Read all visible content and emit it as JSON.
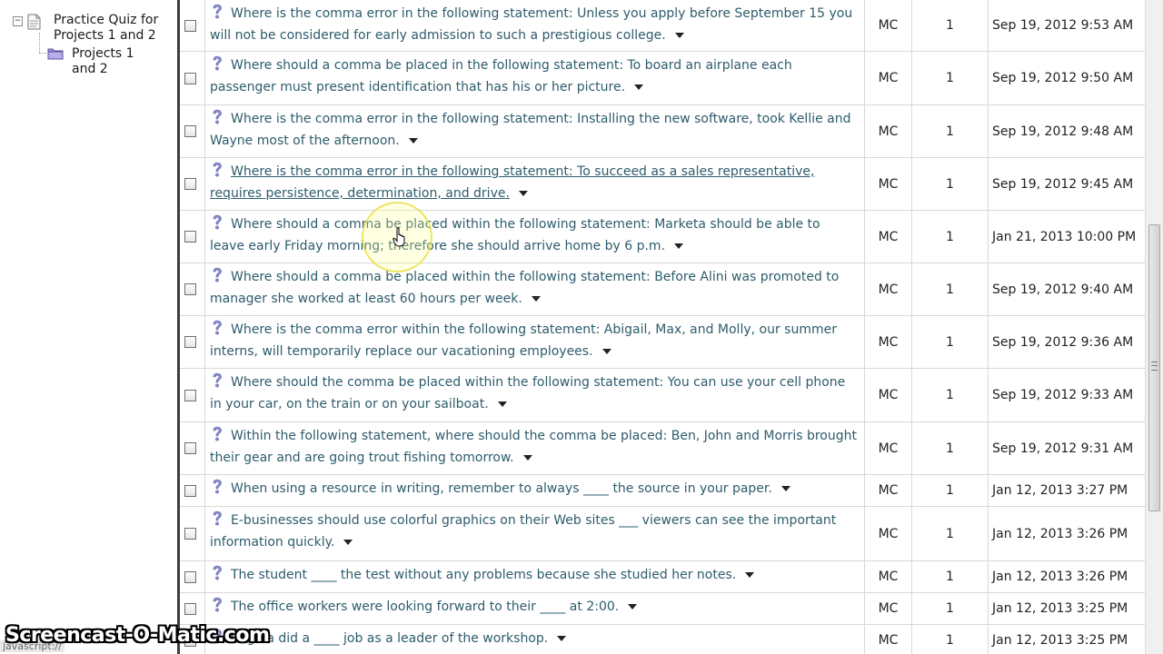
{
  "sidebar": {
    "tree": [
      {
        "label": "Practice Quiz for Projects 1 and 2",
        "icon": "document-icon",
        "expanded": true
      },
      {
        "label": "Projects 1 and 2",
        "icon": "folder-icon"
      }
    ],
    "toggle_symbol": "−"
  },
  "colors": {
    "question_text": "#2d5c6c",
    "divider": "#3c3c3c",
    "help_icon": "#8a8fce"
  },
  "questions": [
    {
      "text": "Where is the comma error in the following statement: Unless you apply before September 15 you will not be considered for early admission to such a prestigious college.",
      "type": "MC",
      "points": "1",
      "date": "Sep 19, 2012 9:53 AM"
    },
    {
      "text": "Where should a comma be placed in the following statement: To board an airplane each passenger must present identification that has his or her picture.",
      "type": "MC",
      "points": "1",
      "date": "Sep 19, 2012 9:50 AM"
    },
    {
      "text": "Where is the comma error in the following statement: Installing the new software, took Kellie and Wayne most of the afternoon.",
      "type": "MC",
      "points": "1",
      "date": "Sep 19, 2012 9:48 AM"
    },
    {
      "text": "Where is the comma error in the following statement: To succeed as a sales representative, requires persistence, determination, and drive.",
      "type": "MC",
      "points": "1",
      "date": "Sep 19, 2012 9:45 AM",
      "hovered": true
    },
    {
      "text": "Where should a comma be placed within the following statement: Marketa should be able to leave early Friday morning; therefore she should arrive home by 6 p.m.",
      "type": "MC",
      "points": "1",
      "date": "Jan 21, 2013 10:00 PM"
    },
    {
      "text": "Where should a comma be placed within the following statement: Before Alini was promoted to manager she worked at least 60 hours per week.",
      "type": "MC",
      "points": "1",
      "date": "Sep 19, 2012 9:40 AM"
    },
    {
      "text": "Where is the comma error within the following statement: Abigail, Max, and Molly, our summer interns, will temporarily replace our vacationing employees.",
      "type": "MC",
      "points": "1",
      "date": "Sep 19, 2012 9:36 AM"
    },
    {
      "text": "Where should the comma be placed within the following statement: You can use your cell phone in your car, on the train or on your sailboat.",
      "type": "MC",
      "points": "1",
      "date": "Sep 19, 2012 9:33 AM"
    },
    {
      "text": "Within the following statement, where should the comma be placed: Ben, John and Morris brought their gear and are going trout fishing tomorrow.",
      "type": "MC",
      "points": "1",
      "date": "Sep 19, 2012 9:31 AM"
    },
    {
      "text": "When using a resource in writing, remember to always ____ the source in your paper.",
      "type": "MC",
      "points": "1",
      "date": "Jan 12, 2013 3:27 PM"
    },
    {
      "text": "E-businesses should use colorful graphics on their Web sites ___ viewers can see the important information quickly.",
      "type": "MC",
      "points": "1",
      "date": "Jan 12, 2013 3:26 PM"
    },
    {
      "text": "The student ____ the test without any problems because she studied her notes.",
      "type": "MC",
      "points": "1",
      "date": "Jan 12, 2013 3:26 PM"
    },
    {
      "text": "The office workers were looking forward to their ____ at 2:00.",
      "type": "MC",
      "points": "1",
      "date": "Jan 12, 2013 3:25 PM"
    },
    {
      "text": "Regina did a ____ job as a leader of the workshop.",
      "type": "MC",
      "points": "1",
      "date": "Jan 12, 2013 3:25 PM"
    }
  ],
  "icons": {
    "question": "help-icon",
    "menu": "chevron-down-icon",
    "checkbox": "checkbox"
  },
  "watermark": "Screencast-O-Matic.com",
  "status_text": "javascript://"
}
